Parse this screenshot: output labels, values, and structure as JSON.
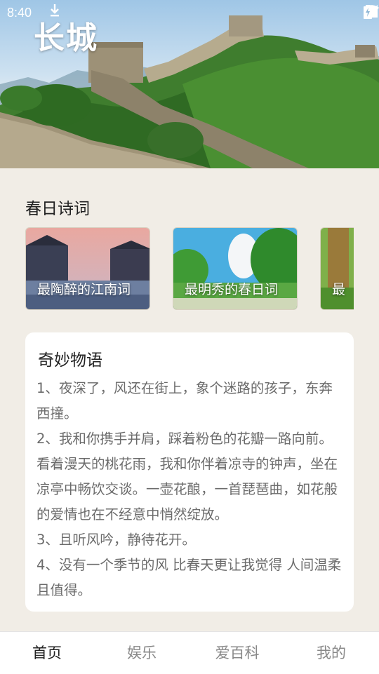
{
  "status": {
    "time": "8:40"
  },
  "hero": {
    "title": "长城"
  },
  "poems": {
    "title": "春日诗词",
    "cards": [
      {
        "label": "最陶醉的江南词"
      },
      {
        "label": "最明秀的春日词"
      },
      {
        "label": "最"
      }
    ]
  },
  "story": {
    "title": "奇妙物语",
    "paragraphs": [
      "1、夜深了，风还在街上，象个迷路的孩子，东奔西撞。",
      "2、我和你携手并肩，踩着粉色的花瓣一路向前。看着漫天的桃花雨，我和你伴着凉寺的钟声，坐在凉亭中畅饮交谈。一壶花酿，一首琵琶曲，如花般的爱情也在不经意中悄然绽放。",
      "3、且听风吟，静待花开。",
      "4、没有一个季节的风 比春天更让我觉得 人间温柔且值得。"
    ]
  },
  "tabs": [
    {
      "label": "首页",
      "active": true
    },
    {
      "label": "娱乐",
      "active": false
    },
    {
      "label": "爱百科",
      "active": false
    },
    {
      "label": "我的",
      "active": false
    }
  ],
  "icons": {
    "download": "download-icon",
    "wifi": "wifi-icon",
    "signal": "signal-icon",
    "battery": "battery-charging-icon"
  }
}
